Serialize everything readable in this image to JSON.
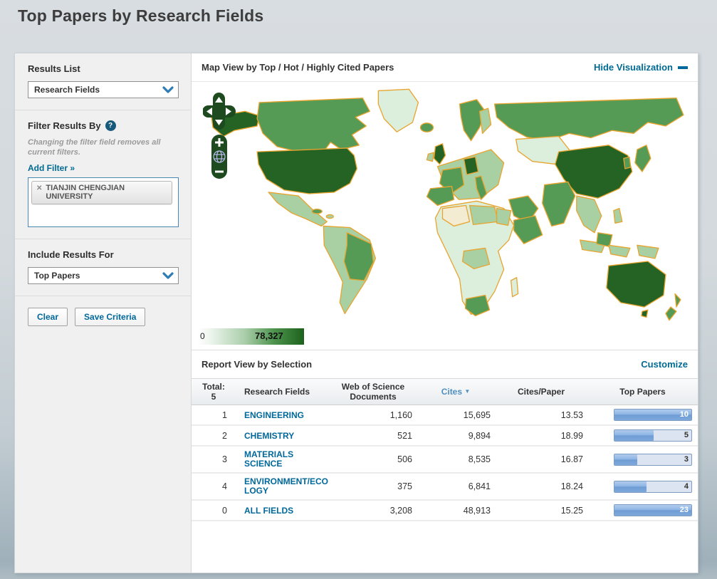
{
  "page": {
    "title": "Top Papers by Research Fields"
  },
  "sidebar": {
    "results_list": {
      "label": "Results List",
      "value": "Research Fields"
    },
    "filter": {
      "heading": "Filter Results By",
      "note": "Changing the filter field removes all current filters.",
      "add_filter_label": "Add Filter »",
      "tags": [
        {
          "label": "TIANJIN CHENGJIAN UNIVERSITY"
        }
      ]
    },
    "include_results": {
      "label": "Include Results For",
      "value": "Top Papers"
    },
    "buttons": {
      "clear": "Clear",
      "save": "Save Criteria"
    }
  },
  "map_view": {
    "header": "Map View by Top / Hot / Highly Cited Papers",
    "hide_link": "Hide Visualization",
    "icons": {
      "hide": "minus-icon",
      "pan": "pan-cross",
      "zoom_in": "plus",
      "zoom_out": "minus",
      "world": "globe"
    },
    "legend": {
      "min": "0",
      "max": "78,327",
      "color_low": "#ffffff",
      "color_high": "#1c611c"
    }
  },
  "report": {
    "header": "Report View by Selection",
    "customize_link": "Customize",
    "table": {
      "headers": {
        "total_line1": "Total:",
        "total_line2": "5",
        "field": "Research Fields",
        "docs": "Web of Science Documents",
        "cites": "Cites",
        "sort_icon": "caret-down",
        "cites_per_paper": "Cites/Paper",
        "top_papers": "Top Papers"
      },
      "rows": [
        {
          "rank": "1",
          "field": "ENGINEERING",
          "docs": "1,160",
          "cites": "15,695",
          "cites_per_paper": "13.53",
          "top_papers": "10",
          "bar_pct": 100
        },
        {
          "rank": "2",
          "field": "CHEMISTRY",
          "docs": "521",
          "cites": "9,894",
          "cites_per_paper": "18.99",
          "top_papers": "5",
          "bar_pct": 51
        },
        {
          "rank": "3",
          "field": "MATERIALS SCIENCE",
          "docs": "506",
          "cites": "8,535",
          "cites_per_paper": "16.87",
          "top_papers": "3",
          "bar_pct": 30
        },
        {
          "rank": "4",
          "field": "ENVIRONMENT/ECOLOGY",
          "docs": "375",
          "cites": "6,841",
          "cites_per_paper": "18.24",
          "top_papers": "4",
          "bar_pct": 42
        },
        {
          "rank": "0",
          "field": "ALL FIELDS",
          "docs": "3,208",
          "cites": "48,913",
          "cites_per_paper": "15.25",
          "top_papers": "23",
          "bar_pct": 100
        }
      ]
    }
  }
}
